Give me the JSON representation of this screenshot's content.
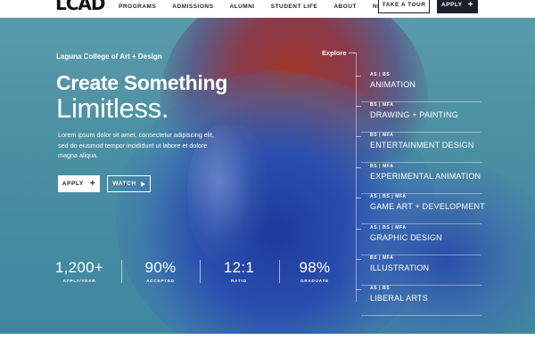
{
  "brand": {
    "logo": "LCAD"
  },
  "nav": {
    "items": [
      "PROGRAMS",
      "ADMISSIONS",
      "ALUMNI",
      "STUDENT LIFE",
      "ABOUT",
      "NEWS"
    ],
    "tour_label": "TAKE A TOUR",
    "apply_label": "APPLY",
    "apply_icon": "+"
  },
  "hero": {
    "college": "Laguna College of Art + Design",
    "headline_line1": "Create Something",
    "headline_line2": "Limitless.",
    "body": "Lorem ipsum dolor sit amet, consectetur adipiscing elit, sed do eiusmod tempor incididunt ut labore et dolore magna aliqua.",
    "apply_label": "APPLY",
    "apply_icon": "+",
    "watch_label": "WATCH"
  },
  "stats": [
    {
      "value": "1,200+",
      "label": "APPLY/YEAR"
    },
    {
      "value": "90%",
      "label": "ACCEPTED"
    },
    {
      "value": "12:1",
      "label": "RATIO"
    },
    {
      "value": "98%",
      "label": "GRADUATE"
    }
  ],
  "explore": {
    "label": "Explore",
    "programs": [
      {
        "degrees": "AS | BS",
        "name": "ANIMATION"
      },
      {
        "degrees": "BS | MFA",
        "name": "DRAWING + PAINTING"
      },
      {
        "degrees": "BS | MFA",
        "name": "ENTERTAINMENT DESIGN"
      },
      {
        "degrees": "BS | MFA",
        "name": "EXPERIMENTAL ANIMATION"
      },
      {
        "degrees": "AS | BS | MFA",
        "name": "GAME ART + DEVELOPMENT"
      },
      {
        "degrees": "AS | BS | MFA",
        "name": "GRAPHIC DESIGN"
      },
      {
        "degrees": "BS | MFA",
        "name": "ILLUSTRATION"
      },
      {
        "degrees": "AS | BS",
        "name": "LIBERAL ARTS"
      }
    ]
  },
  "colors": {
    "navy": "#1c1f2b",
    "hero_teal": "#4b8fa2",
    "hero_red": "#a0362a",
    "hero_blue": "#1e3a9a"
  }
}
